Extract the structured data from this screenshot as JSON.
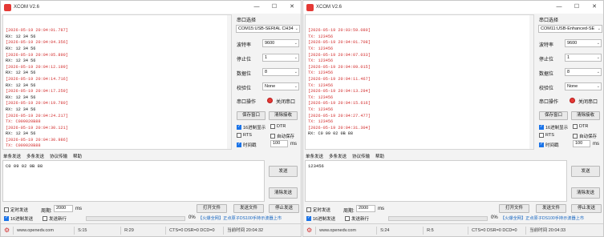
{
  "windows": [
    {
      "title": "XCOM V2.6",
      "rx_lines": [
        {
          "t": "ts",
          "v": "[2026-05-19 20:04:01.787]"
        },
        {
          "t": "rl",
          "v": "RX: 12 34 56"
        },
        {
          "t": "ts",
          "v": "[2026-05-19 20:04:04.356]"
        },
        {
          "t": "rl",
          "v": "RX: 12 34 56"
        },
        {
          "t": "ts",
          "v": "[2026-05-19 20:04:05.890]"
        },
        {
          "t": "rl",
          "v": "RX: 12 34 56"
        },
        {
          "t": "ts",
          "v": "[2026-05-19 20:04:12.199]"
        },
        {
          "t": "rl",
          "v": "RX: 12 34 56"
        },
        {
          "t": "ts",
          "v": "[2026-05-19 20:04:14.716]"
        },
        {
          "t": "rl",
          "v": "RX: 12 34 56"
        },
        {
          "t": "ts",
          "v": "[2026-05-19 20:04:17.259]"
        },
        {
          "t": "rl",
          "v": "RX: 12 34 56"
        },
        {
          "t": "ts",
          "v": "[2026-05-19 20:04:19.780]"
        },
        {
          "t": "rl",
          "v": "RX: 12 34 56"
        },
        {
          "t": "ts",
          "v": "[2026-05-19 20:04:24.217]"
        },
        {
          "t": "tl",
          "v": "TX: C009020B88"
        },
        {
          "t": "ts",
          "v": "[2026-05-19 20:04:30.121]"
        },
        {
          "t": "rl",
          "v": "RX: 12 34 56"
        },
        {
          "t": "ts",
          "v": "[2026-05-19 20:04:30.986]"
        },
        {
          "t": "tl",
          "v": "TX: C009020B88"
        }
      ],
      "port_label": "串口选择",
      "port_value": "COM15:USB-SERIAL CH34",
      "baud_label": "波特率",
      "baud_value": "9600",
      "stop_label": "停止位",
      "stop_value": "1",
      "data_label": "数据位",
      "data_value": "8",
      "parity_label": "校验位",
      "parity_value": "None",
      "op_label": "串口操作",
      "close_port": "关闭串口",
      "save_window": "保存窗口",
      "clear_recv": "清除接收",
      "hex_display": "16进制显示",
      "dtr": "DTR",
      "rts": "RTS",
      "auto_save": "自动保存",
      "timestamp": "时间戳",
      "timestamp_ms": "100",
      "ms": "ms",
      "tabs": [
        "单条发送",
        "多条发送",
        "协议传输",
        "帮助"
      ],
      "tx_text": "C0 09 02 0B 88",
      "send": "发送",
      "clear_send": "清除发送",
      "timed_send": "定时发送",
      "period_label": "周期:",
      "period_value": "2000",
      "open_file": "打开文件",
      "send_file": "发送文件",
      "stop_send": "停止发送",
      "hex_send": "16进制发送",
      "send_newline": "发送新行",
      "percent": "0%",
      "ad": "【火爆全网】正点原子DS100手持示波器上市",
      "status_url": "www.openedv.com",
      "status_s": "S:15",
      "status_r": "R:29",
      "status_lines": "CTS=0 DSR=0 DCD=0",
      "status_time": "当前时间 20:04:32"
    },
    {
      "title": "XCOM V2.6",
      "rx_lines": [
        {
          "t": "ts",
          "v": "[2026-05-19 20:03:59.080]"
        },
        {
          "t": "tl",
          "v": "TX: 123456"
        },
        {
          "t": "ts",
          "v": "[2026-05-19 20:04:01.708]"
        },
        {
          "t": "tl",
          "v": "TX: 123456"
        },
        {
          "t": "ts",
          "v": "[2026-05-19 20:04:07.033]"
        },
        {
          "t": "tl",
          "v": "TX: 123456"
        },
        {
          "t": "ts",
          "v": "[2026-05-19 20:04:09.015]"
        },
        {
          "t": "tl",
          "v": "TX: 123456"
        },
        {
          "t": "ts",
          "v": "[2026-05-19 20:04:11.467]"
        },
        {
          "t": "tl",
          "v": "TX: 123456"
        },
        {
          "t": "ts",
          "v": "[2026-05-19 20:04:13.294]"
        },
        {
          "t": "tl",
          "v": "TX: 123456"
        },
        {
          "t": "ts",
          "v": "[2026-05-19 20:04:15.616]"
        },
        {
          "t": "tl",
          "v": "TX: 123456"
        },
        {
          "t": "ts",
          "v": "[2026-05-19 20:04:27.477]"
        },
        {
          "t": "tl",
          "v": "TX: 123456"
        },
        {
          "t": "ts",
          "v": "[2026-05-19 20:04:31.304]"
        },
        {
          "t": "rl",
          "v": "RX: C0 09 02 0B 88"
        }
      ],
      "port_label": "串口选择",
      "port_value": "COM11:USB-Enhanced-SE",
      "baud_label": "波特率",
      "baud_value": "9600",
      "stop_label": "停止位",
      "stop_value": "1",
      "data_label": "数据位",
      "data_value": "8",
      "parity_label": "校验位",
      "parity_value": "None",
      "op_label": "串口操作",
      "close_port": "关闭串口",
      "save_window": "保存窗口",
      "clear_recv": "清除接收",
      "hex_display": "16进制显示",
      "dtr": "DTR",
      "rts": "RTS",
      "auto_save": "自动保存",
      "timestamp": "时间戳",
      "timestamp_ms": "100",
      "ms": "ms",
      "tabs": [
        "单条发送",
        "多条发送",
        "协议传输",
        "帮助"
      ],
      "tx_text": "123456",
      "send": "发送",
      "clear_send": "清除发送",
      "timed_send": "定时发送",
      "period_label": "周期:",
      "period_value": "2000",
      "open_file": "打开文件",
      "send_file": "发送文件",
      "stop_send": "停止发送",
      "hex_send": "16进制发送",
      "send_newline": "发送新行",
      "percent": "0%",
      "ad": "【火爆全网】正点原子DS100手持示波器上市",
      "status_url": "www.openedv.com",
      "status_s": "S:24",
      "status_r": "R:5",
      "status_lines": "CTS=0 DSR=0 DCD=0",
      "status_time": "当前时间 20:04:33"
    }
  ]
}
